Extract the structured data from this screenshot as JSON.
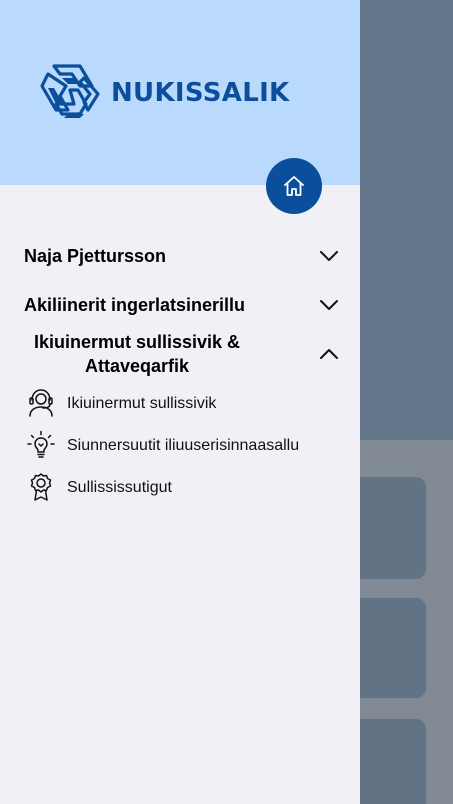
{
  "brand": {
    "name": "NUKISSALIK",
    "color": "#0b4f9c"
  },
  "header": {
    "background": "#b9dafd",
    "home_icon": "home-icon"
  },
  "menu": {
    "sections": [
      {
        "label": "Naja Pjettursson",
        "expanded": false,
        "icon": "chevron-down-icon"
      },
      {
        "label": "Akiliinerit ingerlatsinerillu",
        "expanded": false,
        "icon": "chevron-down-icon"
      },
      {
        "label": "Ikiuinermut sullissivik & Attaveqarfik",
        "expanded": true,
        "icon": "chevron-up-icon"
      }
    ],
    "sub_items": [
      {
        "label": "Ikiuinermut sullissivik",
        "icon": "headset-support-icon"
      },
      {
        "label": "Siunnersuutit iliuuserisinnaasallu",
        "icon": "lightbulb-icon"
      },
      {
        "label": "Sullississutigut",
        "icon": "award-ribbon-icon"
      }
    ]
  }
}
